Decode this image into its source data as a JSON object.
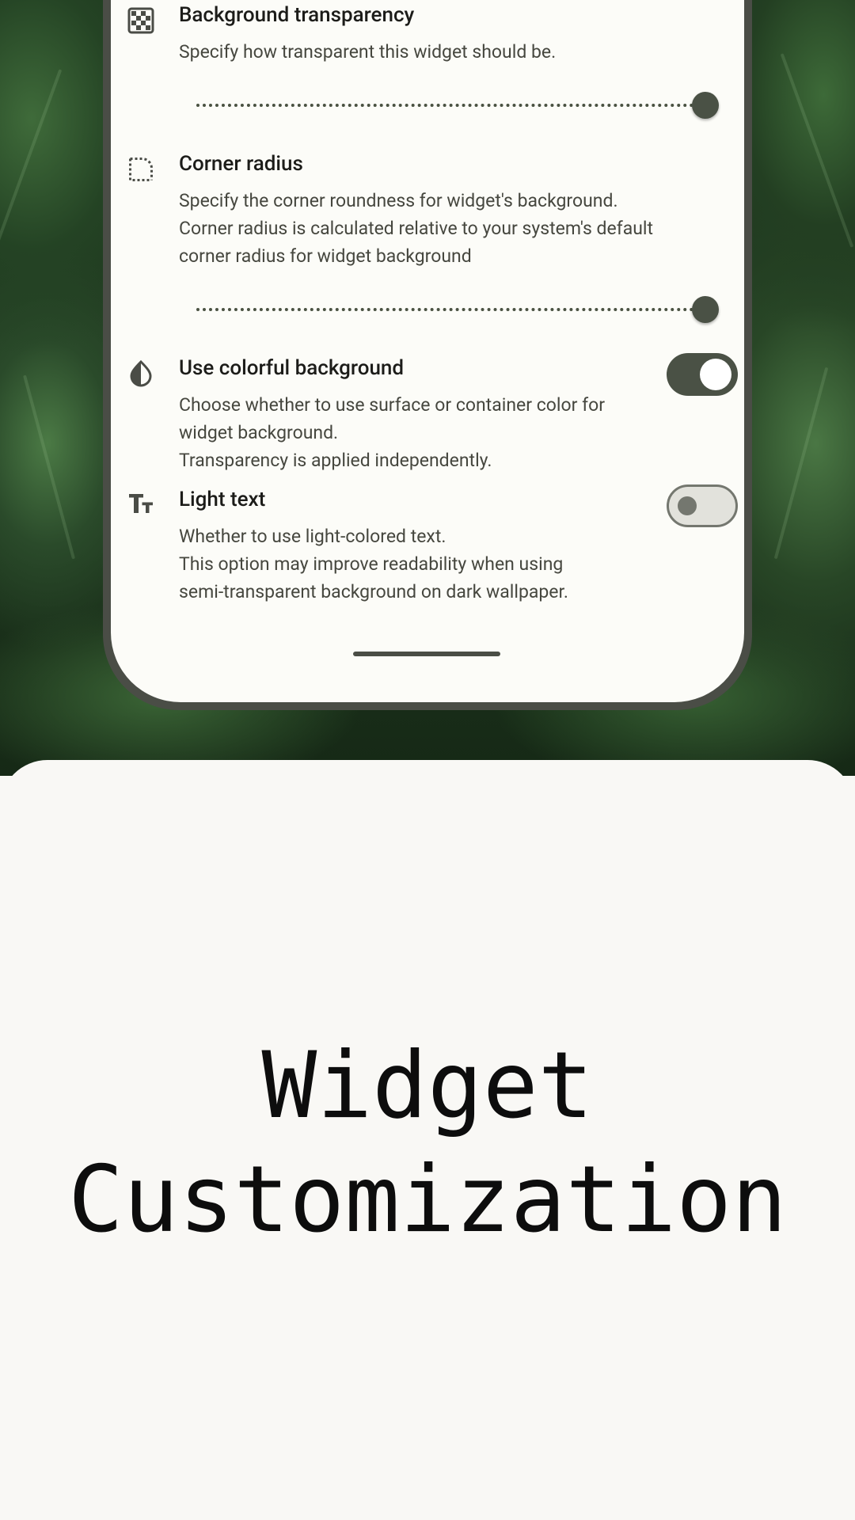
{
  "settings": {
    "background_transparency": {
      "icon": "checkerboard-transparency-icon",
      "title": "Background transparency",
      "description": [
        "Specify how transparent this widget should be."
      ],
      "value_fraction": 1.0
    },
    "corner_radius": {
      "icon": "rounded-corner-icon",
      "title": "Corner radius",
      "description": [
        "Specify the corner roundness for widget's background.",
        "Corner radius is calculated relative to your system's default",
        "corner radius for widget background"
      ],
      "value_fraction": 1.0
    },
    "colorful_background": {
      "icon": "contrast-drop-icon",
      "title": "Use colorful background",
      "description": [
        "Choose whether to use surface or container color for",
        "widget background.",
        "Transparency is applied independently."
      ],
      "enabled": true
    },
    "light_text": {
      "icon": "text-size-icon",
      "title": "Light text",
      "description": [
        "Whether to use light-colored text.",
        "This option may improve readability when using",
        "semi-transparent background on dark wallpaper."
      ],
      "enabled": false
    }
  },
  "headline": [
    "Widget",
    "Customization"
  ],
  "colors": {
    "accent": "#4a5145",
    "screen_bg": "#fcfcf8",
    "page_bg": "#f9f8f5"
  }
}
